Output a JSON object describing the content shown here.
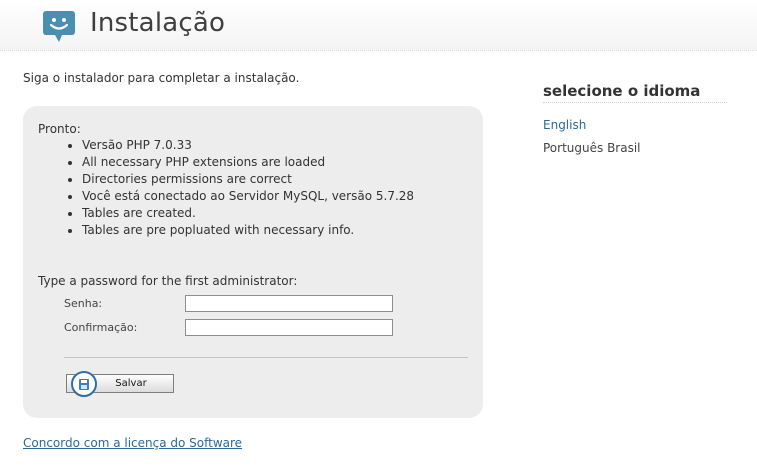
{
  "header": {
    "title": "Instalação",
    "logo_icon": "speech-bubble-smiley-icon"
  },
  "intro": "Siga o instalador para completar a instalação.",
  "status": {
    "heading": "Pronto:",
    "items": [
      "Versão PHP 7.0.33",
      "All necessary PHP extensions are loaded",
      "Directories permissions are correct",
      "Você está conectado ao Servidor MySQL, versão 5.7.28",
      "Tables are created.",
      "Tables are pre popluated with necessary info."
    ]
  },
  "admin": {
    "heading": "Type a password for the first administrator:",
    "password_label": "Senha:",
    "password_value": "",
    "confirm_label": "Confirmação:",
    "confirm_value": ""
  },
  "save": {
    "label": "Salvar",
    "icon": "save-icon"
  },
  "license_link": "Concordo com a licença do Software",
  "languages": {
    "title": "selecione o idioma",
    "items": [
      "English",
      "Português Brasil"
    ]
  },
  "colors": {
    "accent": "#4a8fb0",
    "link": "#2a6a99",
    "panel": "#ededed"
  }
}
